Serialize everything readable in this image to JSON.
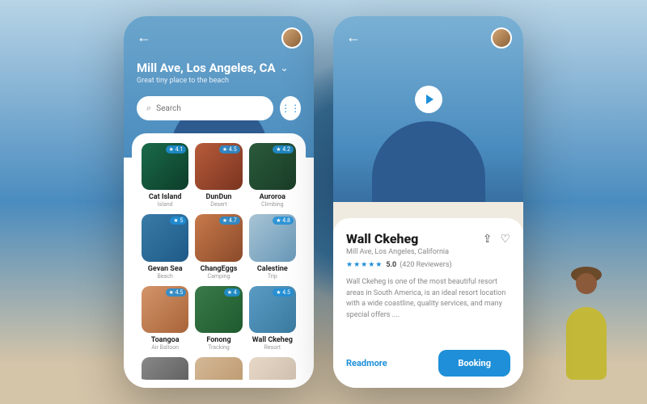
{
  "screen1": {
    "location": "Mill Ave, Los Angeles, CA",
    "subtitle": "Great tiny place to the beach",
    "search_placeholder": "Search",
    "cards": [
      {
        "title": "Cat Island",
        "sub": "Island",
        "rating": "4.1"
      },
      {
        "title": "DunDun",
        "sub": "Desert",
        "rating": "4.5"
      },
      {
        "title": "Auroroa",
        "sub": "Climbing",
        "rating": "4.2"
      },
      {
        "title": "Gevan Sea",
        "sub": "Beach",
        "rating": "5"
      },
      {
        "title": "ChangEggs",
        "sub": "Camping",
        "rating": "4.7"
      },
      {
        "title": "Calestine",
        "sub": "Trip",
        "rating": "4.8"
      },
      {
        "title": "Toangoa",
        "sub": "Air Balloon",
        "rating": "4.5"
      },
      {
        "title": "Fonong",
        "sub": "Tracking",
        "rating": "4"
      },
      {
        "title": "Wall Ckeheg",
        "sub": "Resort",
        "rating": "4.5"
      },
      {
        "title": "",
        "sub": "",
        "rating": ""
      },
      {
        "title": "",
        "sub": "",
        "rating": ""
      },
      {
        "title": "",
        "sub": "",
        "rating": ""
      }
    ]
  },
  "screen2": {
    "title": "Wall Ckeheg",
    "location": "Mill Ave, Los Angeles, California",
    "rating": "5.0",
    "reviews": "(420 Reviewers)",
    "description": "Wall Ckeheg is one of the most beautiful resort areas in South America, is an ideal resort location with a wide coastline, quality services, and many special offers ....",
    "readmore": "Readmore",
    "booking": "Booking"
  }
}
